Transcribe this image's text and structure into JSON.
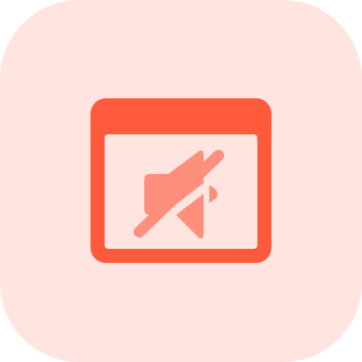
{
  "icon": {
    "name": "browser-window-muted-speaker-icon",
    "colors": {
      "tile_background": "#FFE4E0",
      "window_frame": "#FF5A3C",
      "window_content": "#FFE4E0",
      "speaker": "#FF8F7D",
      "mute_slash": "#FF8F7D"
    }
  }
}
